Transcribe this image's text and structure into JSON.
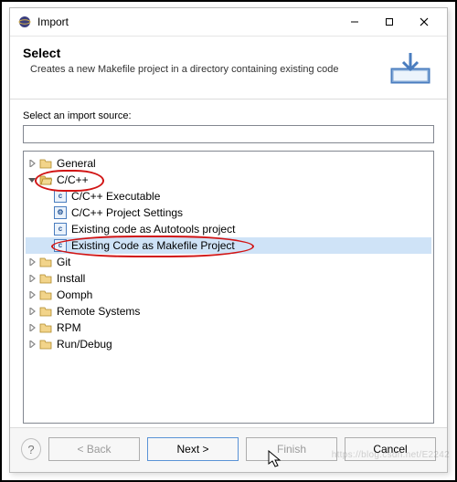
{
  "window": {
    "title": "Import"
  },
  "header": {
    "title": "Select",
    "description": "Creates a new Makefile project in a directory containing existing code"
  },
  "body": {
    "source_label": "Select an import source:",
    "filter_value": "",
    "filter_placeholder": ""
  },
  "tree": {
    "nodes": [
      {
        "label": "General",
        "type": "folder",
        "expanded": false,
        "depth": 0
      },
      {
        "label": "C/C++",
        "type": "folder",
        "expanded": true,
        "depth": 0,
        "highlighted": true
      },
      {
        "label": "C/C++ Executable",
        "type": "leaf",
        "icon": "c",
        "depth": 1
      },
      {
        "label": "C/C++ Project Settings",
        "type": "leaf",
        "icon": "cfg",
        "depth": 1
      },
      {
        "label": "Existing code as Autotools project",
        "type": "leaf",
        "icon": "c",
        "depth": 1
      },
      {
        "label": "Existing Code as Makefile Project",
        "type": "leaf",
        "icon": "c",
        "depth": 1,
        "selected": true,
        "highlighted": true
      },
      {
        "label": "Git",
        "type": "folder",
        "expanded": false,
        "depth": 0
      },
      {
        "label": "Install",
        "type": "folder",
        "expanded": false,
        "depth": 0
      },
      {
        "label": "Oomph",
        "type": "folder",
        "expanded": false,
        "depth": 0
      },
      {
        "label": "Remote Systems",
        "type": "folder",
        "expanded": false,
        "depth": 0
      },
      {
        "label": "RPM",
        "type": "folder",
        "expanded": false,
        "depth": 0
      },
      {
        "label": "Run/Debug",
        "type": "folder",
        "expanded": false,
        "depth": 0
      }
    ]
  },
  "footer": {
    "back": "< Back",
    "next": "Next >",
    "finish": "Finish",
    "cancel": "Cancel"
  },
  "watermark": "https://blog.csdn.net/E2242"
}
